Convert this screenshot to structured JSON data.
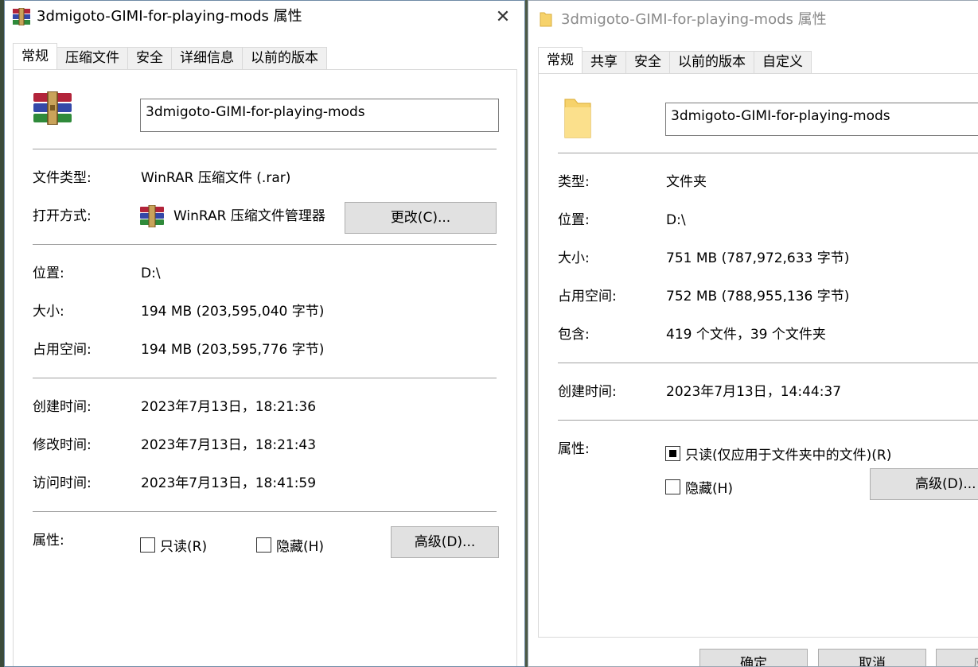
{
  "dialog1": {
    "title": "3dmigoto-GIMI-for-playing-mods 属性",
    "tabs": [
      "常规",
      "压缩文件",
      "安全",
      "详细信息",
      "以前的版本"
    ],
    "filename": "3dmigoto-GIMI-for-playing-mods",
    "file_type_label": "文件类型:",
    "file_type_value": "WinRAR 压缩文件 (.rar)",
    "open_with_label": "打开方式:",
    "open_with_value": "WinRAR 压缩文件管理器",
    "change_button": "更改(C)...",
    "location_label": "位置:",
    "location_value": "D:\\",
    "size_label": "大小:",
    "size_value": "194 MB (203,595,040 字节)",
    "disk_size_label": "占用空间:",
    "disk_size_value": "194 MB (203,595,776 字节)",
    "created_label": "创建时间:",
    "created_value": "2023年7月13日，18:21:36",
    "modified_label": "修改时间:",
    "modified_value": "2023年7月13日，18:21:43",
    "accessed_label": "访问时间:",
    "accessed_value": "2023年7月13日，18:41:59",
    "attributes_label": "属性:",
    "readonly_label": "只读(R)",
    "hidden_label": "隐藏(H)",
    "advanced_button": "高级(D)...",
    "close_glyph": "✕"
  },
  "dialog2": {
    "title": "3dmigoto-GIMI-for-playing-mods 属性",
    "tabs": [
      "常规",
      "共享",
      "安全",
      "以前的版本",
      "自定义"
    ],
    "filename": "3dmigoto-GIMI-for-playing-mods",
    "type_label": "类型:",
    "type_value": "文件夹",
    "location_label": "位置:",
    "location_value": "D:\\",
    "size_label": "大小:",
    "size_value": "751 MB (787,972,633 字节)",
    "disk_size_label": "占用空间:",
    "disk_size_value": "752 MB (788,955,136 字节)",
    "contains_label": "包含:",
    "contains_value": "419 个文件，39 个文件夹",
    "created_label": "创建时间:",
    "created_value": "2023年7月13日，14:44:37",
    "attributes_label": "属性:",
    "readonly_label": "只读(仅应用于文件夹中的文件)(R)",
    "hidden_label": "隐藏(H)",
    "advanced_button": "高级(D)...",
    "ok_button": "确定",
    "cancel_button": "取消",
    "apply_button": "应"
  }
}
